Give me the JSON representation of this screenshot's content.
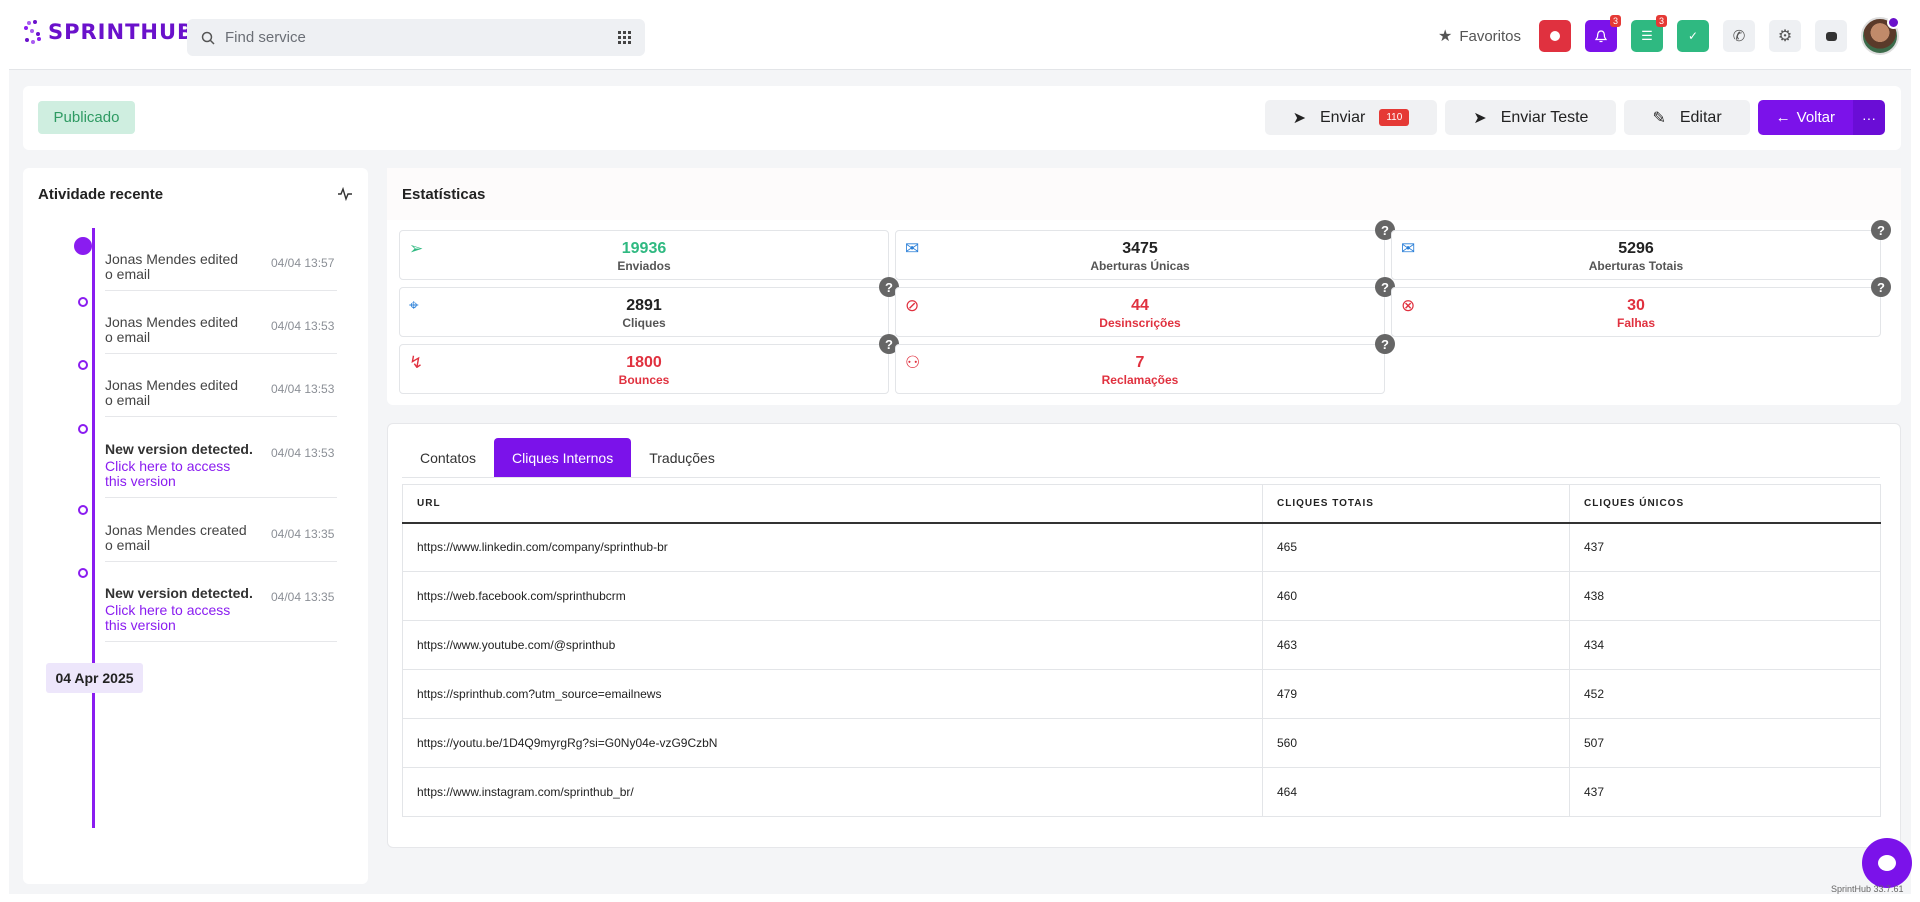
{
  "header": {
    "logo_text": "SPRINTHUB",
    "search_placeholder": "Find service",
    "favorites_label": "Favoritos",
    "notif_badge_1": "3",
    "notif_badge_2": "3"
  },
  "actionbar": {
    "status": "Publicado",
    "send_label": "Enviar",
    "send_count": "110",
    "send_test_label": "Enviar Teste",
    "edit_label": "Editar",
    "back_label": "Voltar",
    "more_label": "···"
  },
  "activity": {
    "title": "Atividade recente",
    "items": [
      {
        "line1": "Jonas Mendes edited",
        "line2": "o email",
        "time": "04/04 13:57"
      },
      {
        "line1": "Jonas Mendes edited",
        "line2": "o email",
        "time": "04/04 13:53"
      },
      {
        "line1": "Jonas Mendes edited",
        "line2": "o email",
        "time": "04/04 13:53"
      },
      {
        "line1": "New version detected.",
        "line2": "Click here to access this version",
        "time": "04/04 13:53"
      },
      {
        "line1": "Jonas Mendes created",
        "line2": "o email",
        "time": "04/04 13:35"
      },
      {
        "line1": "New version detected.",
        "line2": "Click here to access this version",
        "time": "04/04 13:35"
      }
    ],
    "date_label": "04 Apr 2025"
  },
  "stats": {
    "title": "Estatísticas",
    "items": [
      {
        "value": "19936",
        "label": "Enviados"
      },
      {
        "value": "3475",
        "label": "Aberturas Únicas"
      },
      {
        "value": "5296",
        "label": "Aberturas Totais"
      },
      {
        "value": "2891",
        "label": "Cliques"
      },
      {
        "value": "44",
        "label": "Desinscrições"
      },
      {
        "value": "30",
        "label": "Falhas"
      },
      {
        "value": "1800",
        "label": "Bounces"
      },
      {
        "value": "7",
        "label": "Reclamações"
      }
    ],
    "help_label": "?"
  },
  "tabs": {
    "items": [
      "Contatos",
      "Cliques Internos",
      "Traduções"
    ],
    "active": "Cliques Internos"
  },
  "table": {
    "headers": [
      "URL",
      "CLIQUES TOTAIS",
      "CLIQUES ÚNICOS"
    ],
    "rows": [
      [
        "https://www.linkedin.com/company/sprinthub-br",
        "465",
        "437"
      ],
      [
        "https://web.facebook.com/sprinthubcrm",
        "460",
        "438"
      ],
      [
        "https://www.youtube.com/@sprinthub",
        "463",
        "434"
      ],
      [
        "https://sprinthub.com?utm_source=emailnews",
        "479",
        "452"
      ],
      [
        "https://youtu.be/1D4Q9myrgRg?si=G0Ny04e-vzG9CzbN",
        "560",
        "507"
      ],
      [
        "https://www.instagram.com/sprinthub_br/",
        "464",
        "437"
      ]
    ]
  },
  "footer": {
    "version": "SprintHub 33.7.61"
  },
  "colors": {
    "accent": "#7b12ea",
    "success": "#2fb981",
    "danger": "#e0313f"
  }
}
